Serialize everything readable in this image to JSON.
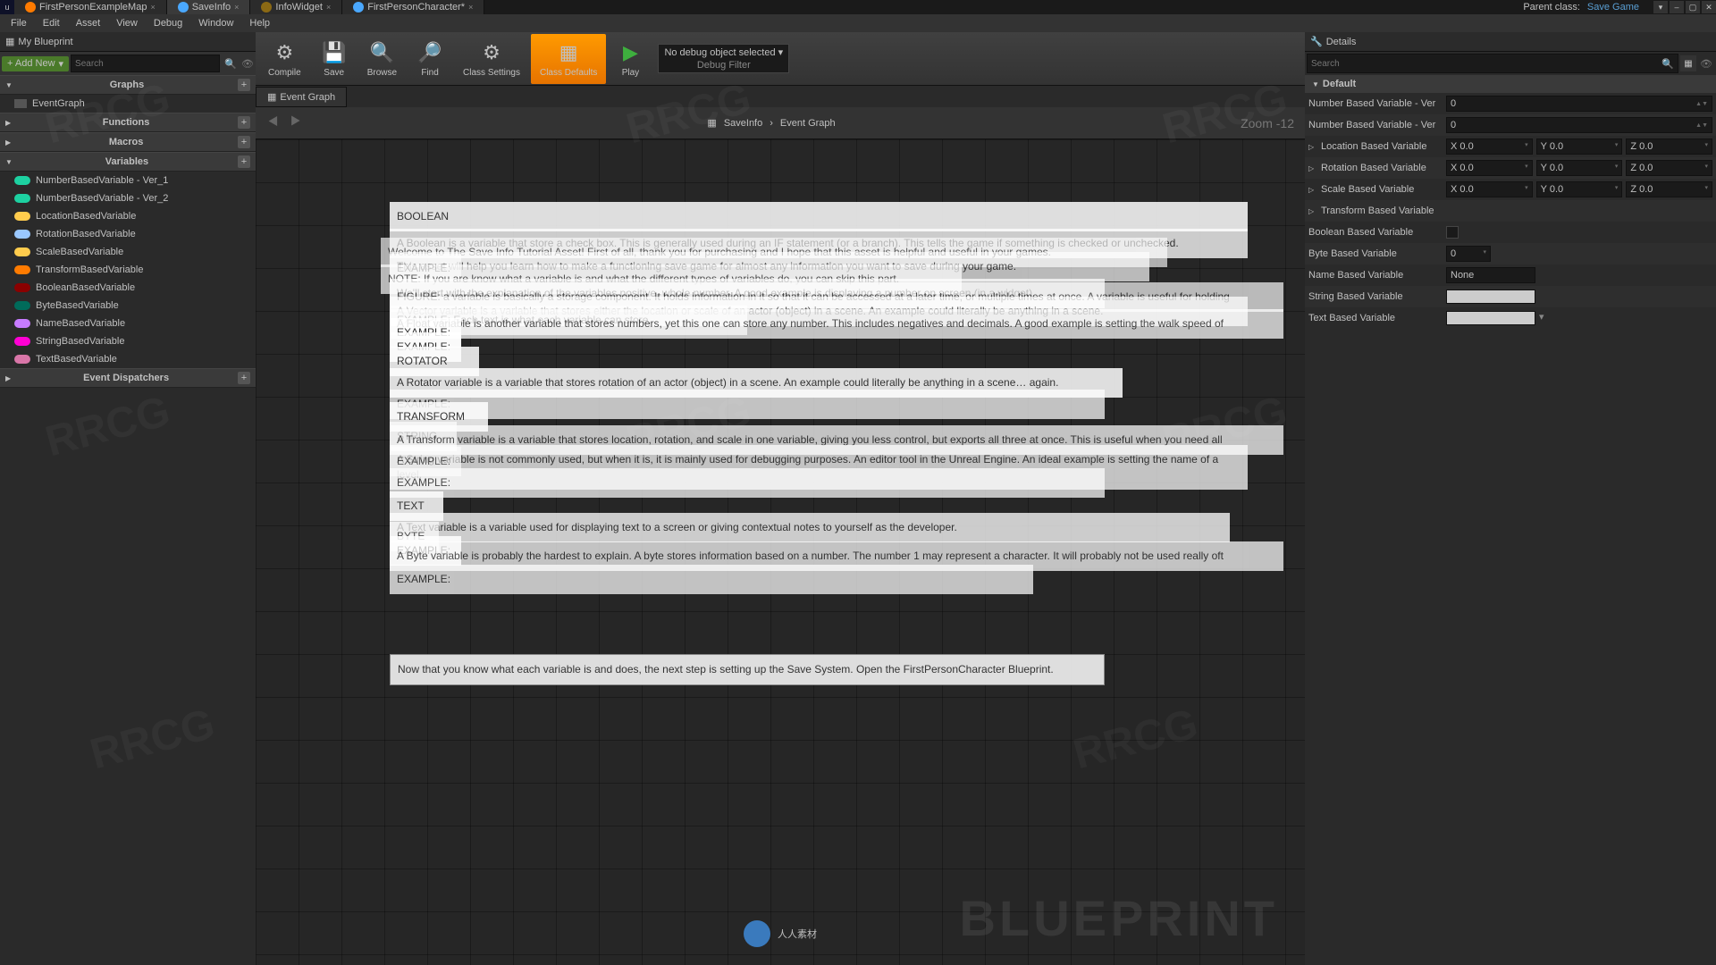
{
  "titlebar": {
    "tabs": [
      {
        "label": "FirstPersonExampleMap",
        "icon": "orange"
      },
      {
        "label": "SaveInfo",
        "icon": "blue",
        "active": true
      },
      {
        "label": "InfoWidget",
        "icon": "brown"
      },
      {
        "label": "FirstPersonCharacter*",
        "icon": "blue"
      }
    ],
    "parent_label": "Parent class:",
    "parent_class": "Save Game"
  },
  "window_buttons": {
    "min": "–",
    "max": "▢",
    "close": "✕",
    "extra": "▾"
  },
  "menubar": [
    "File",
    "Edit",
    "Asset",
    "View",
    "Debug",
    "Window",
    "Help"
  ],
  "left": {
    "panel_title": "My Blueprint",
    "add_new": "+ Add New",
    "search_placeholder": "Search",
    "sections": {
      "graphs": {
        "title": "Graphs",
        "items": [
          {
            "label": "EventGraph"
          }
        ]
      },
      "functions": {
        "title": "Functions"
      },
      "macros": {
        "title": "Macros"
      },
      "variables": {
        "title": "Variables",
        "items": [
          {
            "label": "NumberBasedVariable - Ver_1",
            "pill": "int"
          },
          {
            "label": "NumberBasedVariable - Ver_2",
            "pill": "int"
          },
          {
            "label": "LocationBasedVariable",
            "pill": "vec"
          },
          {
            "label": "RotationBasedVariable",
            "pill": "rot"
          },
          {
            "label": "ScaleBasedVariable",
            "pill": "vec"
          },
          {
            "label": "TransformBasedVariable",
            "pill": "trans"
          },
          {
            "label": "BooleanBasedVariable",
            "pill": "bool"
          },
          {
            "label": "ByteBasedVariable",
            "pill": "byte"
          },
          {
            "label": "NameBasedVariable",
            "pill": "name"
          },
          {
            "label": "StringBasedVariable",
            "pill": "string"
          },
          {
            "label": "TextBasedVariable",
            "pill": "text"
          }
        ]
      },
      "dispatchers": {
        "title": "Event Dispatchers"
      }
    }
  },
  "toolbar": {
    "buttons": [
      {
        "label": "Compile",
        "icon": "⚙"
      },
      {
        "label": "Save",
        "icon": "💾"
      },
      {
        "label": "Browse",
        "icon": "🔍"
      },
      {
        "label": "Find",
        "icon": "🔎"
      },
      {
        "label": "Class Settings",
        "icon": "⚙"
      },
      {
        "label": "Class Defaults",
        "icon": "▦",
        "active": true
      },
      {
        "label": "Play",
        "icon": "▶"
      }
    ],
    "debug_object": "No debug object selected ▾",
    "debug_filter": "Debug Filter"
  },
  "graph": {
    "tab": "Event Graph",
    "breadcrumb_root": "SaveInfo",
    "breadcrumb_current": "Event Graph",
    "zoom": "Zoom -12",
    "blueprint_wm": "BLUEPRINT"
  },
  "comments": {
    "c1": "BOOLEAN",
    "c2": "A Boolean is a variable that store a check box. This is generally used during an IF statement (or a branch). This tells the game if something is checked or unchecked.",
    "c3": "Welcome to The Save Info Tutorial Asset! First of all, thank you for purchasing and I hope that this asset is helpful and useful in your games.",
    "c4": "This asset will help you learn how to make a functioning save game for almost any information you want to save during your game.",
    "c5": "EXAMPLE:",
    "c6": "NOTE: If you are know what a variable is and what the different types of variables do, you can skip this part.",
    "c7": "We'll start with the explanation of the variables positive, whole number. A good example is displaying a number on screen (in a widget).",
    "c8": "FIGURE: a variable is basically a storage component. It holds information in it so that it can be accessed at a later time, or multiple times at once. A variable is useful for holding",
    "c9": "A Vector variable is a variable that stores either the location or scale of an actor (object) in a scene. An example could literally be anything in a scene.",
    "c10": "EXAMPLE: Each text is what each variable can store.",
    "c11": "A Float variable is another variable that stores numbers, yet this one can store any number. This includes negatives and decimals. A good example is setting the walk speed of",
    "c12": "EXAMPLE:",
    "c13": "EXAMPLE:",
    "c14": "ROTATOR",
    "c15": "A Rotator variable is a variable that stores rotation of an actor (object) in a scene. An example could literally be anything in a scene… again.",
    "c16": "EXAMPLE:",
    "c17": "TRANSFORM",
    "c18": "STRING",
    "c19": "A Transform variable is a variable that stores location, rotation, and scale in one variable, giving you less control, but exports all three at once. This is useful when you need all",
    "c20": "A String variable is not commonly used, but when it is, it is mainly used for debugging purposes. An editor tool in the Unreal Engine. An ideal example is setting the name of a level.",
    "c21": "EXAMPLE:",
    "c22": "EXAMPLE:",
    "c23": "TEXT",
    "c24": "A Text variable is a variable used for displaying text to a screen or giving contextual notes to yourself as the developer.",
    "c25": "BYTE",
    "c26": "EXAMPLE:",
    "c27": "A Byte variable is probably the hardest to explain. A byte stores information based on a number. The number 1 may represent a character. It will probably not be used really oft",
    "c28": "EXAMPLE:",
    "c29": "Now that you know what each variable is and does, the next step is setting up the Save System. Open the FirstPersonCharacter Blueprint."
  },
  "details": {
    "title": "Details",
    "search_placeholder": "Search",
    "section": "Default",
    "props": {
      "num1": {
        "label": "Number Based Variable - Ver",
        "value": "0"
      },
      "num2": {
        "label": "Number Based Variable - Ver",
        "value": "0"
      },
      "loc": {
        "label": "Location Based Variable",
        "x": "X 0.0",
        "y": "Y 0.0",
        "z": "Z 0.0"
      },
      "rot": {
        "label": "Rotation Based Variable",
        "x": "X 0.0",
        "y": "Y 0.0",
        "z": "Z 0.0"
      },
      "scale": {
        "label": "Scale Based Variable",
        "x": "X 0.0",
        "y": "Y 0.0",
        "z": "Z 0.0"
      },
      "trans": {
        "label": "Transform Based Variable"
      },
      "bool": {
        "label": "Boolean Based Variable"
      },
      "byte": {
        "label": "Byte Based Variable",
        "value": "0"
      },
      "name": {
        "label": "Name Based Variable",
        "value": "None"
      },
      "string": {
        "label": "String Based Variable"
      },
      "text": {
        "label": "Text Based Variable"
      }
    }
  },
  "footer": "人人素材"
}
